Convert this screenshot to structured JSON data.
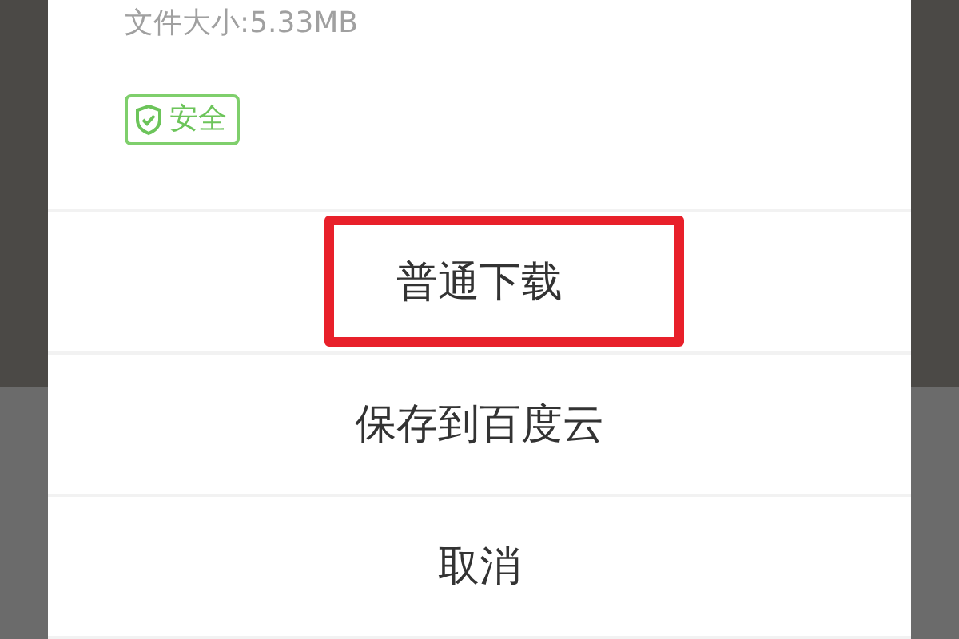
{
  "file_size": "文件大小:5.33MB",
  "badge": {
    "label": "安全"
  },
  "actions": [
    {
      "label": "普通下载",
      "highlighted": true
    },
    {
      "label": "保存到百度云",
      "highlighted": false
    },
    {
      "label": "取消",
      "highlighted": false
    }
  ]
}
